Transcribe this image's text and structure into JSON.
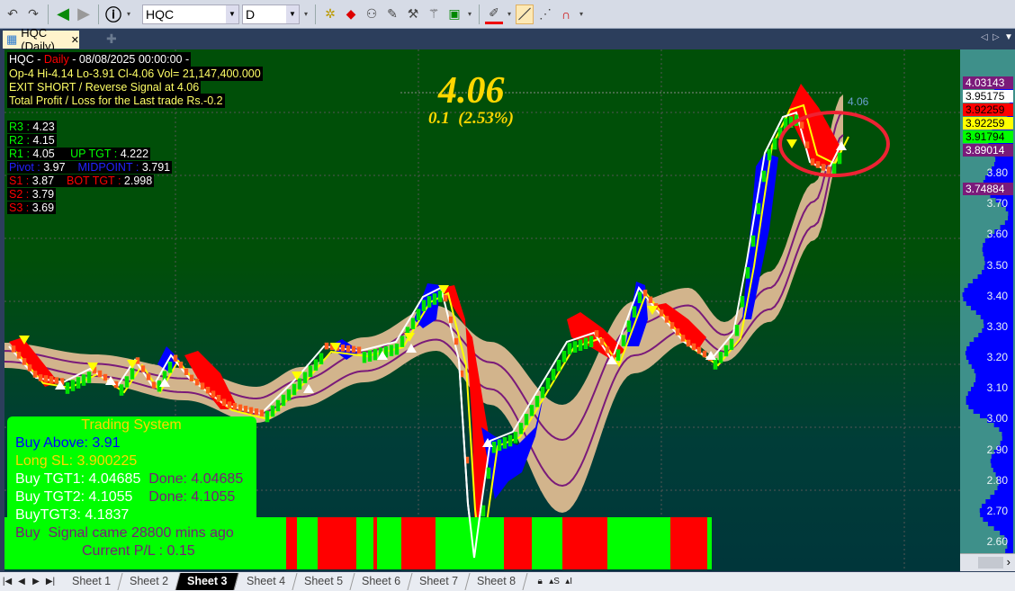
{
  "toolbar": {
    "symbol": "HQC",
    "interval": "D"
  },
  "tab": {
    "label": "HQC (Daily)",
    "close": "✕"
  },
  "header": {
    "symbol": "HQC -",
    "period": "Daily",
    "datetime": "- 08/08/2025 00:00:00 -",
    "ohlc": "Op-4  Hi-4.14  Lo-3.91  Cl-4.06  Vol= 21,147,400.000",
    "signal": " EXIT SHORT / Reverse Signal at 4.06",
    "pl": "Total Profit / Loss for the Last trade Rs.-0.2"
  },
  "levels": {
    "r3": "4.23",
    "r2": "4.15",
    "r1": "4.05",
    "pivot": "3.97",
    "s1": "3.87",
    "s2": "3.79",
    "s3": "3.69",
    "r3_label": "R3 :",
    "r2_label": "R2 :",
    "r1_label": "R1 :",
    "pivot_label": "Pivot :",
    "s1_label": "S1 :",
    "s2_label": "S2 :",
    "s3_label": "S3 :",
    "up_tgt_label": "UP TGT   :",
    "up_tgt": "4.222",
    "midpoint_label": "MIDPOINT :",
    "midpoint": "3.791",
    "bot_tgt_label": "BOT TGT  :",
    "bot_tgt": "2.998"
  },
  "big_price": {
    "price": "4.06",
    "change": "0.1  (2.53%)",
    "last_label": "4.06"
  },
  "trading_system": {
    "title": "Trading System",
    "buy_above": "Buy Above: 3.91",
    "long_sl": "Long SL: 3.900225",
    "tgt1": "Buy TGT1: 4.04685",
    "tgt1_done": "Done: 4.04685",
    "tgt2": "Buy TGT2: 4.1055",
    "tgt2_done": "Done: 4.1055",
    "tgt3": "BuyTGT3: 4.1837",
    "signal": "Buy  Signal came 28800 mins ago",
    "current_pl": "Current P/L : 0.15"
  },
  "price_axis": [
    "3.80",
    "3.70",
    "3.60",
    "3.50",
    "3.40",
    "3.30",
    "3.20",
    "3.10",
    "3.00",
    "2.90",
    "2.80",
    "2.70",
    "2.60"
  ],
  "price_boxes": [
    {
      "value": "4.03143",
      "bg": "#7a1a7a",
      "fg": "#ffffff"
    },
    {
      "value": "3.95175",
      "bg": "#ffffff",
      "fg": "#000000"
    },
    {
      "value": "3.92259",
      "bg": "#ff0000",
      "fg": "#000000"
    },
    {
      "value": "3.92259",
      "bg": "#ffff00",
      "fg": "#000000"
    },
    {
      "value": "3.91794",
      "bg": "#00ff00",
      "fg": "#000000"
    },
    {
      "value": "3.89014",
      "bg": "#7a1a7a",
      "fg": "#ffffff"
    },
    {
      "value": "3.74884",
      "bg": "#7a1a7a",
      "fg": "#ffffff"
    }
  ],
  "sheets": [
    "Sheet 1",
    "Sheet 2",
    "Sheet 3",
    "Sheet 4",
    "Sheet 5",
    "Sheet 6",
    "Sheet 7",
    "Sheet 8"
  ],
  "active_sheet": "Sheet 3",
  "colors": {
    "bull": "#00ff00",
    "bear": "#ff0000",
    "band": "#d2b48c",
    "accent": "#ffd700"
  }
}
